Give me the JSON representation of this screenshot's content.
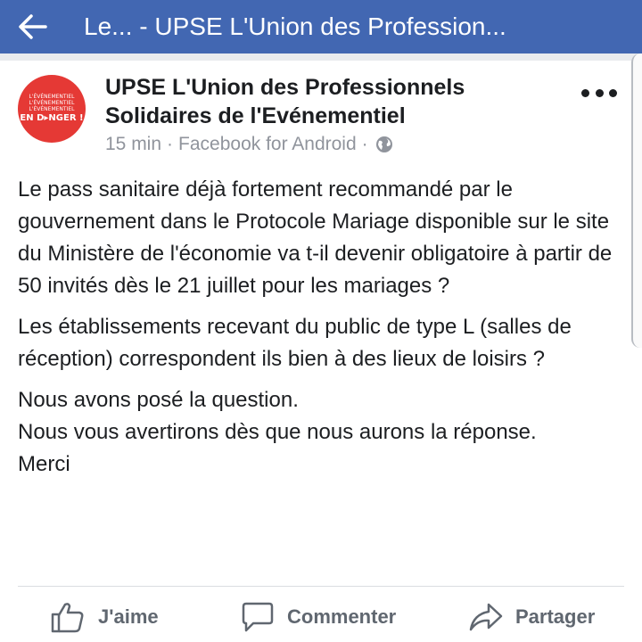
{
  "topbar": {
    "title": "Le... - UPSE L'Union des Profession...",
    "back_icon": "arrow-left-icon",
    "color": "#4267b2"
  },
  "post": {
    "avatar": {
      "lines": [
        "L'ÉVÉNEMENTIEL",
        "L'ÉVÉNEMENTIEL",
        "L'ÉVÉNEMENTIEL"
      ],
      "big": "EN D▸NGER !",
      "color": "#e53935"
    },
    "page_name": "UPSE L'Union des Professionnels Solidaires de l'Evénementiel",
    "time": "15 min",
    "separator": "·",
    "source": "Facebook for Android",
    "separator2": "·",
    "privacy_icon": "globe-icon",
    "more_icon": "more-dots-icon",
    "paragraphs": [
      "Le pass sanitaire déjà fortement recommandé par le gouvernement dans le Protocole Mariage disponible sur le site du Ministère de l'économie va t-il devenir obligatoire à partir de 50 invités dès le 21 juillet pour les mariages ?",
      "Les établissements recevant du public de type L (salles de réception) correspondent ils bien à des lieux de loisirs ?"
    ],
    "closing_lines": [
      "Nous avons posé la question.",
      "Nous vous avertirons dès que nous aurons la réponse.",
      "Merci"
    ]
  },
  "actions": {
    "like_label": "J'aime",
    "like_icon": "thumbs-up-icon",
    "comment_label": "Commenter",
    "comment_icon": "comment-bubble-icon",
    "share_label": "Partager",
    "share_icon": "share-arrow-icon"
  }
}
